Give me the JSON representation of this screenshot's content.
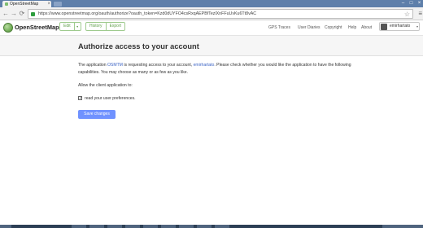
{
  "browser": {
    "tab_title": "OpenStreetMap",
    "tab_close": "×",
    "window_controls": [
      "–",
      "□",
      "×"
    ],
    "nav_icons": [
      "←",
      "→",
      "⟳"
    ],
    "url": "https://www.openstreetmap.org/oauth/authorize?oauth_token=Kzd0dUYFO4csRxqAEPBfTezlXnFFuUvKu6Tt8vAC",
    "star_icon": "☆",
    "menu_icon": "≡"
  },
  "header": {
    "logo": "OpenStreetMap",
    "edit": "Edit",
    "edit_caret": "▾",
    "history": "History",
    "export": "Export",
    "nav": [
      "GPS Traces",
      "User Diaries",
      "Copyright",
      "Help",
      "About"
    ],
    "user": "emirhartato",
    "user_caret": "▾"
  },
  "content": {
    "title": "Authorize access to your account",
    "p1_a": "The application ",
    "app_name": "OSMTM",
    "p1_b": " is requesting access to your account, ",
    "user_link": "emirhartato",
    "p1_c": ". Please check whether you would like the application to have the following capabilities. You may choose as many or as few as you like.",
    "allow_text": "Allow the client application to:",
    "permission_label": "read your user preferences.",
    "permission_checked": true,
    "check_glyph": "✓",
    "save_button": "Save changes"
  },
  "colors": {
    "osm_green": "#7ebc6f",
    "link_blue": "#3b63c4",
    "button_blue": "#7092ff"
  }
}
